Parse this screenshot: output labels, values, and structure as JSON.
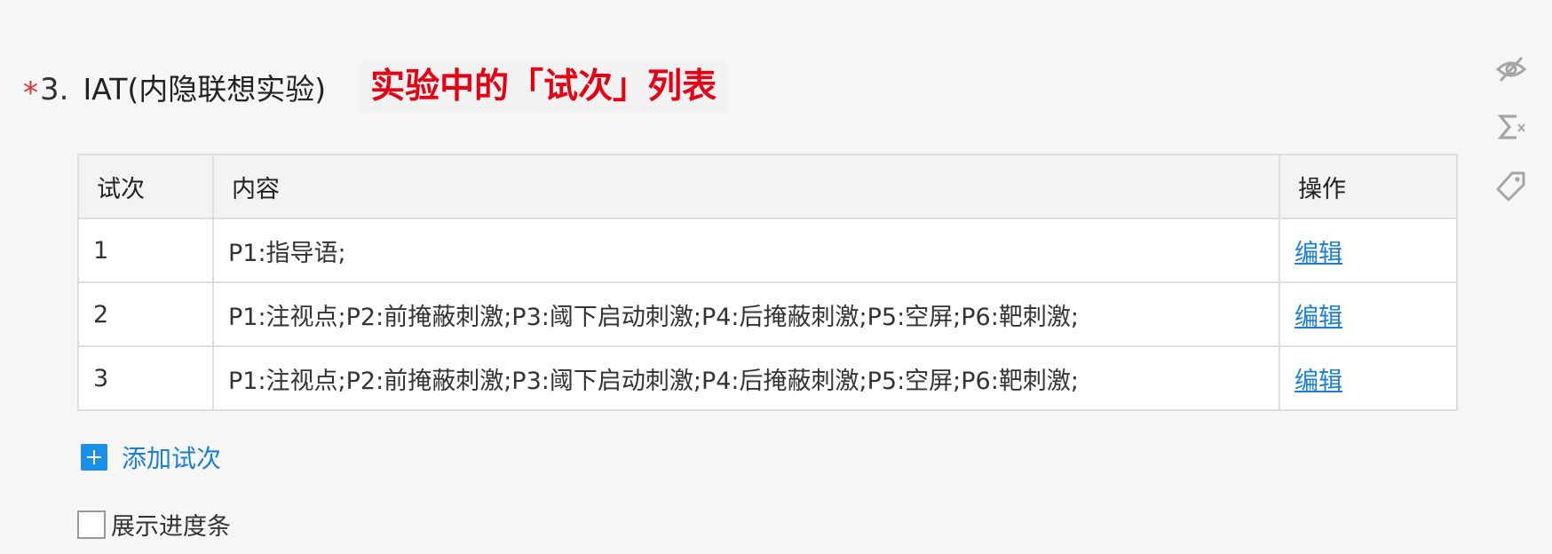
{
  "question": {
    "required_mark": "*",
    "number": "3.",
    "title": "IAT(内隐联想实验)",
    "annotation": "实验中的「试次」列表"
  },
  "side_tools": [
    {
      "icon": "eye-slash-icon"
    },
    {
      "icon": "sigma-formula-icon"
    },
    {
      "icon": "tag-icon"
    }
  ],
  "table": {
    "headers": {
      "trial": "试次",
      "content": "内容",
      "operation": "操作"
    },
    "rows": [
      {
        "trial": "1",
        "content": "P1:指导语;",
        "action": "编辑"
      },
      {
        "trial": "2",
        "content": "P1:注视点;P2:前掩蔽刺激;P3:阈下启动刺激;P4:后掩蔽刺激;P5:空屏;P6:靶刺激;",
        "action": "编辑"
      },
      {
        "trial": "3",
        "content": "P1:注视点;P2:前掩蔽刺激;P3:阈下启动刺激;P4:后掩蔽刺激;P5:空屏;P6:靶刺激;",
        "action": "编辑"
      }
    ]
  },
  "add_trial": {
    "label": "添加试次"
  },
  "progress_option": {
    "label": "展示进度条",
    "checked": false
  },
  "colors": {
    "accent": "#1a8fe6",
    "annotation": "#e60012",
    "required": "#e3342f"
  }
}
